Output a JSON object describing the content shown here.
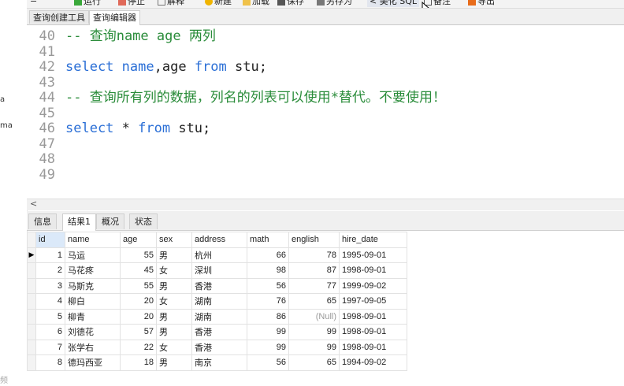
{
  "toolbar": {
    "items": [
      "运行",
      "停止",
      "解释",
      "新建",
      "加载",
      "保存",
      "另存为",
      "美化 SQL",
      "备注",
      "导出"
    ]
  },
  "editor_tabs": [
    "查询创建工具",
    "查询编辑器"
  ],
  "editor": {
    "lines": [
      {
        "num": "40",
        "parts": [
          {
            "t": "cmt",
            "v": "-- 查询name age 两列"
          }
        ]
      },
      {
        "num": "41",
        "parts": []
      },
      {
        "num": "42",
        "parts": [
          {
            "t": "kw",
            "v": "select"
          },
          {
            "t": "tx",
            "v": " "
          },
          {
            "t": "kw",
            "v": "name"
          },
          {
            "t": "tx",
            "v": ",age "
          },
          {
            "t": "kw",
            "v": "from"
          },
          {
            "t": "tx",
            "v": " stu;"
          }
        ]
      },
      {
        "num": "43",
        "parts": []
      },
      {
        "num": "44",
        "parts": [
          {
            "t": "cmt",
            "v": "-- 查询所有列的数据，列名的列表可以使用*替代。不要使用！"
          }
        ]
      },
      {
        "num": "45",
        "parts": []
      },
      {
        "num": "46",
        "parts": [
          {
            "t": "kw",
            "v": "select"
          },
          {
            "t": "tx",
            "v": " * "
          },
          {
            "t": "kw",
            "v": "from"
          },
          {
            "t": "tx",
            "v": " stu;"
          }
        ]
      },
      {
        "num": "47",
        "parts": []
      },
      {
        "num": "48",
        "parts": []
      },
      {
        "num": "49",
        "parts": []
      }
    ]
  },
  "left_fragments": [
    "a",
    "ma",
    "频"
  ],
  "scroll_arrow": "<",
  "result_tabs": [
    "信息",
    "结果1",
    "概况",
    "状态"
  ],
  "results": {
    "columns": [
      "id",
      "name",
      "age",
      "sex",
      "address",
      "math",
      "english",
      "hire_date"
    ],
    "rows": [
      [
        "1",
        "马运",
        "55",
        "男",
        "杭州",
        "66",
        "78",
        "1995-09-01"
      ],
      [
        "2",
        "马花疼",
        "45",
        "女",
        "深圳",
        "98",
        "87",
        "1998-09-01"
      ],
      [
        "3",
        "马斯克",
        "55",
        "男",
        "香港",
        "56",
        "77",
        "1999-09-02"
      ],
      [
        "4",
        "柳白",
        "20",
        "女",
        "湖南",
        "76",
        "65",
        "1997-09-05"
      ],
      [
        "5",
        "柳青",
        "20",
        "男",
        "湖南",
        "86",
        "(Null)",
        "1998-09-01"
      ],
      [
        "6",
        "刘德花",
        "57",
        "男",
        "香港",
        "99",
        "99",
        "1998-09-01"
      ],
      [
        "7",
        "张学右",
        "22",
        "女",
        "香港",
        "99",
        "99",
        "1998-09-01"
      ],
      [
        "8",
        "德玛西亚",
        "18",
        "男",
        "南京",
        "56",
        "65",
        "1994-09-02"
      ]
    ],
    "current_row_marker": "▶"
  },
  "colors": {
    "comment": "#2a8c3a",
    "keyword": "#2b6fd6",
    "line_number": "#999999",
    "selected_header": "#dbe9f9"
  }
}
